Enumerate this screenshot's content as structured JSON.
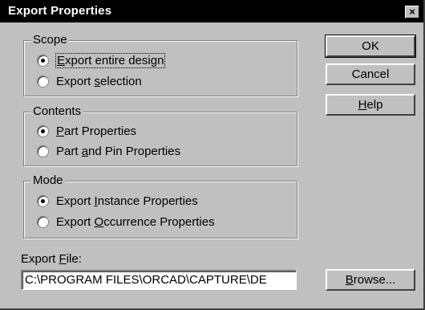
{
  "window": {
    "title": "Export Properties",
    "close_glyph": "×"
  },
  "scope": {
    "label": "Scope",
    "options": [
      {
        "pre": "",
        "key": "E",
        "post": "xport entire design",
        "checked": true
      },
      {
        "pre": "Export ",
        "key": "s",
        "post": "election",
        "checked": false
      }
    ]
  },
  "contents": {
    "label": "Contents",
    "options": [
      {
        "pre": "",
        "key": "P",
        "post": "art Properties",
        "checked": true
      },
      {
        "pre": "Part ",
        "key": "a",
        "post": "nd Pin Properties",
        "checked": false
      }
    ]
  },
  "mode": {
    "label": "Mode",
    "options": [
      {
        "pre": "Export ",
        "key": "I",
        "post": "nstance Properties",
        "checked": true
      },
      {
        "pre": "Export ",
        "key": "O",
        "post": "ccurrence Properties",
        "checked": false
      }
    ]
  },
  "buttons": {
    "ok": "OK",
    "cancel": "Cancel",
    "help": {
      "pre": "",
      "key": "H",
      "post": "elp"
    },
    "browse": {
      "pre": "",
      "key": "B",
      "post": "rowse..."
    }
  },
  "export_file": {
    "label": {
      "pre": "Export ",
      "key": "F",
      "post": "ile:"
    },
    "value": "C:\\PROGRAM FILES\\ORCAD\\CAPTURE\\DE"
  }
}
